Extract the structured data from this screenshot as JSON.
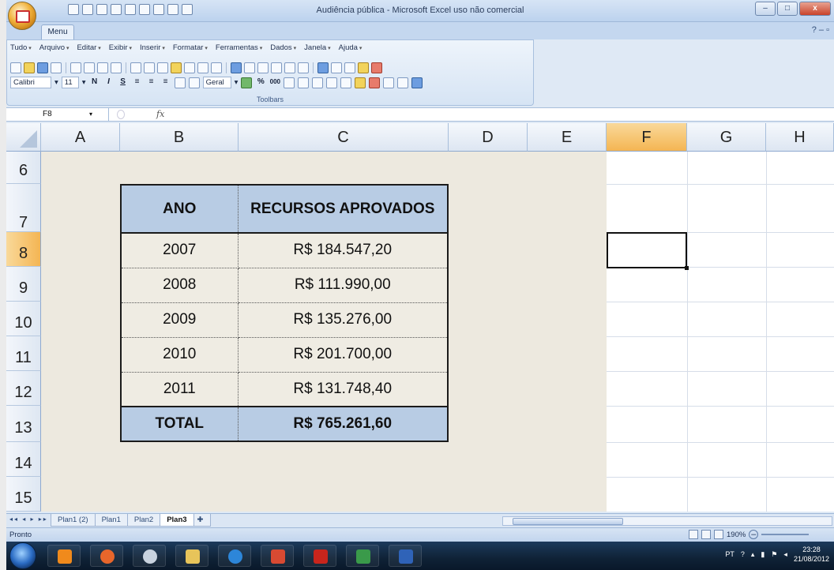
{
  "window": {
    "title": "Audiência pública - Microsoft Excel uso não comercial"
  },
  "ribbon": {
    "tab": "Menu",
    "menus": [
      "Tudo",
      "Arquivo",
      "Editar",
      "Exibir",
      "Inserir",
      "Formatar",
      "Ferramentas",
      "Dados",
      "Janela",
      "Ajuda"
    ],
    "font_name": "Calibri",
    "font_size": "11",
    "number_format": "Geral",
    "group_label": "Toolbars"
  },
  "formula_bar": {
    "name_box": "F8",
    "fx": "fx",
    "content": ""
  },
  "grid": {
    "columns": [
      "A",
      "B",
      "C",
      "D",
      "E",
      "F",
      "G",
      "H"
    ],
    "selected_column": "F",
    "rows": [
      "6",
      "7",
      "8",
      "9",
      "10",
      "11",
      "12",
      "13",
      "14",
      "15"
    ],
    "selected_row": "8"
  },
  "table": {
    "headers": [
      "ANO",
      "RECURSOS APROVADOS"
    ],
    "rows": [
      [
        "2007",
        "R$ 184.547,20"
      ],
      [
        "2008",
        "R$ 111.990,00"
      ],
      [
        "2009",
        "R$ 135.276,00"
      ],
      [
        "2010",
        "R$ 201.700,00"
      ],
      [
        "2011",
        "R$ 131.748,40"
      ]
    ],
    "total": [
      "TOTAL",
      "R$ 765.261,60"
    ]
  },
  "sheets": {
    "tabs": [
      "Plan1 (2)",
      "Plan1",
      "Plan2",
      "Plan3"
    ],
    "active": "Plan3"
  },
  "status": {
    "text": "Pronto",
    "zoom": "190%"
  },
  "taskbar": {
    "lang": "PT",
    "time": "23:28",
    "date": "21/08/2012"
  },
  "colors": {
    "header_fill": "#b8cce4",
    "body_fill": "#efece3",
    "selected_header": "#f4b553"
  }
}
